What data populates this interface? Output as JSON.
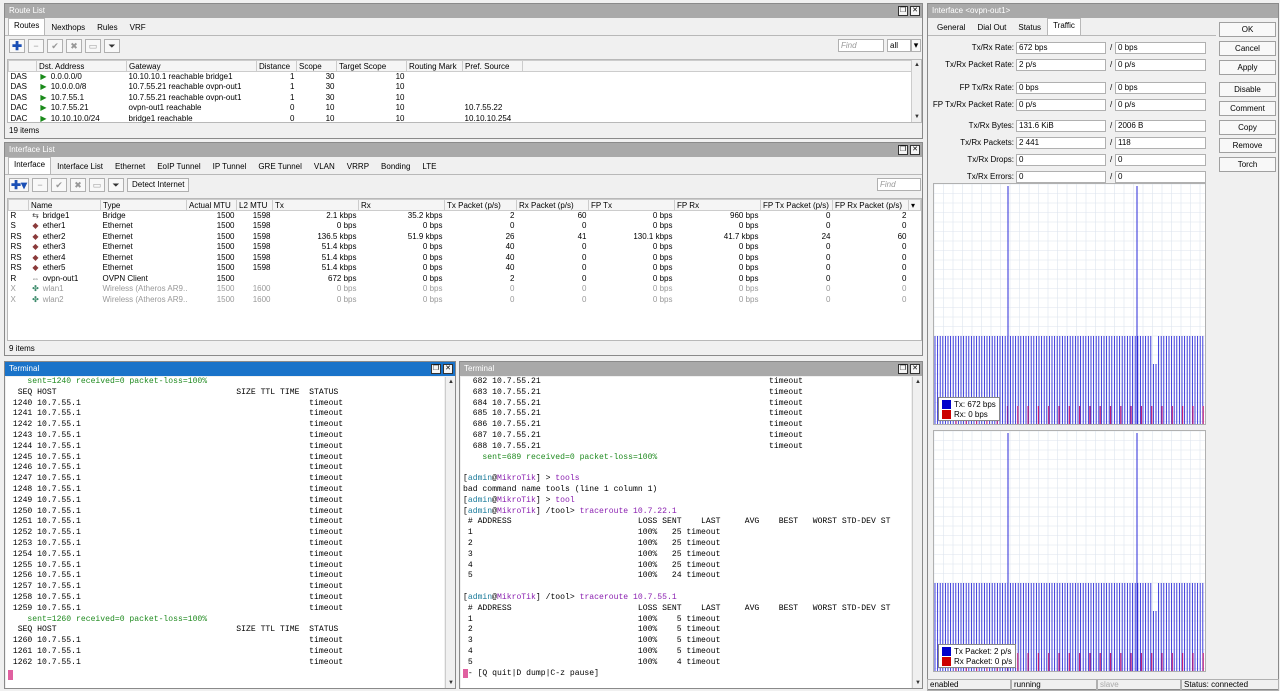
{
  "colors": {
    "titlebar_active": "#1a73c9",
    "titlebar_inactive": "#a9a9a9",
    "tx": "#0000cc",
    "rx": "#cc0000"
  },
  "route_list": {
    "title": "Route List",
    "tabs": [
      "Routes",
      "Nexthops",
      "Rules",
      "VRF"
    ],
    "find_placeholder": "Find",
    "filter_value": "all",
    "columns": [
      "",
      "Dst. Address",
      "Gateway",
      "Distance",
      "Scope",
      "Target Scope",
      "Routing Mark",
      "Pref. Source"
    ],
    "rows": [
      [
        "DAS",
        "0.0.0.0/0",
        "10.10.10.1 reachable bridge1",
        "1",
        "30",
        "10",
        "",
        ""
      ],
      [
        "DAS",
        "10.0.0.0/8",
        "10.7.55.21 reachable ovpn-out1",
        "1",
        "30",
        "10",
        "",
        ""
      ],
      [
        "DAS",
        "10.7.55.1",
        "10.7.55.21 reachable ovpn-out1",
        "1",
        "30",
        "10",
        "",
        ""
      ],
      [
        "DAC",
        "10.7.55.21",
        "ovpn-out1 reachable",
        "0",
        "10",
        "10",
        "",
        "10.7.55.22"
      ],
      [
        "DAC",
        "10.10.10.0/24",
        "bridge1 reachable",
        "0",
        "10",
        "10",
        "",
        "10.10.10.254"
      ]
    ],
    "count": "19 items"
  },
  "interface_list": {
    "title": "Interface List",
    "tabs": [
      "Interface",
      "Interface List",
      "Ethernet",
      "EoIP Tunnel",
      "IP Tunnel",
      "GRE Tunnel",
      "VLAN",
      "VRRP",
      "Bonding",
      "LTE"
    ],
    "detect_button": "Detect Internet",
    "find_placeholder": "Find",
    "columns": [
      "",
      "Name",
      "Type",
      "Actual MTU",
      "L2 MTU",
      "Tx",
      "Rx",
      "Tx Packet (p/s)",
      "Rx Packet (p/s)",
      "FP Tx",
      "FP Rx",
      "FP Tx Packet (p/s)",
      "FP Rx Packet (p/s)"
    ],
    "rows": [
      {
        "flag": "R",
        "icon": "bridge-icon",
        "cells": [
          "bridge1",
          "Bridge",
          "1500",
          "1598",
          "2.1 kbps",
          "35.2 kbps",
          "2",
          "60",
          "0 bps",
          "960 bps",
          "0",
          "2"
        ],
        "disabled": false
      },
      {
        "flag": "S",
        "icon": "ethernet-icon",
        "cells": [
          "ether1",
          "Ethernet",
          "1500",
          "1598",
          "0 bps",
          "0 bps",
          "0",
          "0",
          "0 bps",
          "0 bps",
          "0",
          "0"
        ],
        "disabled": false
      },
      {
        "flag": "RS",
        "icon": "ethernet-icon",
        "cells": [
          "ether2",
          "Ethernet",
          "1500",
          "1598",
          "136.5 kbps",
          "51.9 kbps",
          "26",
          "41",
          "130.1 kbps",
          "41.7 kbps",
          "24",
          "60"
        ],
        "disabled": false
      },
      {
        "flag": "RS",
        "icon": "ethernet-icon",
        "cells": [
          "ether3",
          "Ethernet",
          "1500",
          "1598",
          "51.4 kbps",
          "0 bps",
          "40",
          "0",
          "0 bps",
          "0 bps",
          "0",
          "0"
        ],
        "disabled": false
      },
      {
        "flag": "RS",
        "icon": "ethernet-icon",
        "cells": [
          "ether4",
          "Ethernet",
          "1500",
          "1598",
          "51.4 kbps",
          "0 bps",
          "40",
          "0",
          "0 bps",
          "0 bps",
          "0",
          "0"
        ],
        "disabled": false
      },
      {
        "flag": "RS",
        "icon": "ethernet-icon",
        "cells": [
          "ether5",
          "Ethernet",
          "1500",
          "1598",
          "51.4 kbps",
          "0 bps",
          "40",
          "0",
          "0 bps",
          "0 bps",
          "0",
          "0"
        ],
        "disabled": false
      },
      {
        "flag": "R",
        "icon": "ovpn-icon",
        "cells": [
          "ovpn-out1",
          "OVPN Client",
          "1500",
          "",
          "672 bps",
          "0 bps",
          "2",
          "0",
          "0 bps",
          "0 bps",
          "0",
          "0"
        ],
        "disabled": false
      },
      {
        "flag": "X",
        "icon": "wireless-icon",
        "cells": [
          "wlan1",
          "Wireless (Atheros AR9...",
          "1500",
          "1600",
          "0 bps",
          "0 bps",
          "0",
          "0",
          "0 bps",
          "0 bps",
          "0",
          "0"
        ],
        "disabled": true
      },
      {
        "flag": "X",
        "icon": "wireless-icon",
        "cells": [
          "wlan2",
          "Wireless (Atheros AR9...",
          "1500",
          "1600",
          "0 bps",
          "0 bps",
          "0",
          "0",
          "0 bps",
          "0 bps",
          "0",
          "0"
        ],
        "disabled": true
      }
    ],
    "count": "9 items"
  },
  "terminal1": {
    "title": "Terminal",
    "lines": [
      {
        "t": "    sent=1240 received=0 packet-loss=100%",
        "c": "t-green"
      },
      {
        "t": "  SEQ HOST                                     SIZE TTL TIME  STATUS",
        "c": ""
      },
      {
        "t": " 1240 10.7.55.1                                               timeout",
        "c": ""
      },
      {
        "t": " 1241 10.7.55.1                                               timeout",
        "c": ""
      },
      {
        "t": " 1242 10.7.55.1                                               timeout",
        "c": ""
      },
      {
        "t": " 1243 10.7.55.1                                               timeout",
        "c": ""
      },
      {
        "t": " 1244 10.7.55.1                                               timeout",
        "c": ""
      },
      {
        "t": " 1245 10.7.55.1                                               timeout",
        "c": ""
      },
      {
        "t": " 1246 10.7.55.1                                               timeout",
        "c": ""
      },
      {
        "t": " 1247 10.7.55.1                                               timeout",
        "c": ""
      },
      {
        "t": " 1248 10.7.55.1                                               timeout",
        "c": ""
      },
      {
        "t": " 1249 10.7.55.1                                               timeout",
        "c": ""
      },
      {
        "t": " 1250 10.7.55.1                                               timeout",
        "c": ""
      },
      {
        "t": " 1251 10.7.55.1                                               timeout",
        "c": ""
      },
      {
        "t": " 1252 10.7.55.1                                               timeout",
        "c": ""
      },
      {
        "t": " 1253 10.7.55.1                                               timeout",
        "c": ""
      },
      {
        "t": " 1254 10.7.55.1                                               timeout",
        "c": ""
      },
      {
        "t": " 1255 10.7.55.1                                               timeout",
        "c": ""
      },
      {
        "t": " 1256 10.7.55.1                                               timeout",
        "c": ""
      },
      {
        "t": " 1257 10.7.55.1                                               timeout",
        "c": ""
      },
      {
        "t": " 1258 10.7.55.1                                               timeout",
        "c": ""
      },
      {
        "t": " 1259 10.7.55.1                                               timeout",
        "c": ""
      },
      {
        "t": "    sent=1260 received=0 packet-loss=100%",
        "c": "t-green"
      },
      {
        "t": "  SEQ HOST                                     SIZE TTL TIME  STATUS",
        "c": ""
      },
      {
        "t": " 1260 10.7.55.1                                               timeout",
        "c": ""
      },
      {
        "t": " 1261 10.7.55.1                                               timeout",
        "c": ""
      },
      {
        "t": " 1262 10.7.55.1                                               timeout",
        "c": ""
      }
    ]
  },
  "terminal2": {
    "title": "Terminal",
    "lines": [
      {
        "t": "  682 10.7.55.21                                               timeout",
        "c": ""
      },
      {
        "t": "  683 10.7.55.21                                               timeout",
        "c": ""
      },
      {
        "t": "  684 10.7.55.21                                               timeout",
        "c": ""
      },
      {
        "t": "  685 10.7.55.21                                               timeout",
        "c": ""
      },
      {
        "t": "  686 10.7.55.21                                               timeout",
        "c": ""
      },
      {
        "t": "  687 10.7.55.21                                               timeout",
        "c": ""
      },
      {
        "t": "  688 10.7.55.21                                               timeout",
        "c": ""
      },
      {
        "t": "    sent=689 received=0 packet-loss=100%",
        "c": "t-green"
      },
      {
        "t": "",
        "c": ""
      },
      {
        "t": "[admin@MikroTik] > tools",
        "c": "t-purple"
      },
      {
        "t": "bad command name tools (line 1 column 1)",
        "c": ""
      },
      {
        "t": "[admin@MikroTik] > tool",
        "c": "t-purple"
      },
      {
        "t": "[admin@MikroTik] /tool> traceroute 10.7.22.1",
        "c": "t-purple"
      },
      {
        "t": " # ADDRESS                          LOSS SENT    LAST     AVG    BEST   WORST STD-DEV ST",
        "c": ""
      },
      {
        "t": " 1                                  100%   25 timeout",
        "c": ""
      },
      {
        "t": " 2                                  100%   25 timeout",
        "c": ""
      },
      {
        "t": " 3                                  100%   25 timeout",
        "c": ""
      },
      {
        "t": " 4                                  100%   25 timeout",
        "c": ""
      },
      {
        "t": " 5                                  100%   24 timeout",
        "c": ""
      },
      {
        "t": "",
        "c": ""
      },
      {
        "t": "[admin@MikroTik] /tool> traceroute 10.7.55.1",
        "c": "t-purple"
      },
      {
        "t": " # ADDRESS                          LOSS SENT    LAST     AVG    BEST   WORST STD-DEV ST",
        "c": ""
      },
      {
        "t": " 1                                  100%    5 timeout",
        "c": ""
      },
      {
        "t": " 2                                  100%    5 timeout",
        "c": ""
      },
      {
        "t": " 3                                  100%    5 timeout",
        "c": ""
      },
      {
        "t": " 4                                  100%    5 timeout",
        "c": ""
      },
      {
        "t": " 5                                  100%    4 timeout",
        "c": ""
      },
      {
        "t": "-- [Q quit|D dump|C-z pause]",
        "c": ""
      }
    ]
  },
  "interface_detail": {
    "title": "Interface <ovpn-out1>",
    "tabs": [
      "General",
      "Dial Out",
      "Status",
      "Traffic"
    ],
    "fields": [
      {
        "label": "Tx/Rx Rate:",
        "a": "672 bps",
        "b": "0 bps"
      },
      {
        "label": "Tx/Rx Packet Rate:",
        "a": "2 p/s",
        "b": "0 p/s"
      },
      {
        "label": "FP Tx/Rx Rate:",
        "a": "0 bps",
        "b": "0 bps"
      },
      {
        "label": "FP Tx/Rx Packet Rate:",
        "a": "0 p/s",
        "b": "0 p/s"
      },
      {
        "label": "Tx/Rx Bytes:",
        "a": "131.6 KiB",
        "b": "2006 B"
      },
      {
        "label": "Tx/Rx Packets:",
        "a": "2 441",
        "b": "118"
      },
      {
        "label": "Tx/Rx Drops:",
        "a": "0",
        "b": "0"
      },
      {
        "label": "Tx/Rx Errors:",
        "a": "0",
        "b": "0"
      }
    ],
    "buttons": [
      "OK",
      "Cancel",
      "Apply",
      "Disable",
      "Comment",
      "Copy",
      "Remove",
      "Torch"
    ],
    "graph1_legend": {
      "tx": "Tx:  672 bps",
      "rx": "Rx:  0 bps"
    },
    "graph2_legend": {
      "tx": "Tx Packet:  2 p/s",
      "rx": "Rx Packet:  0 p/s"
    },
    "status": [
      "enabled",
      "running",
      "slave",
      "Status: connected"
    ]
  }
}
